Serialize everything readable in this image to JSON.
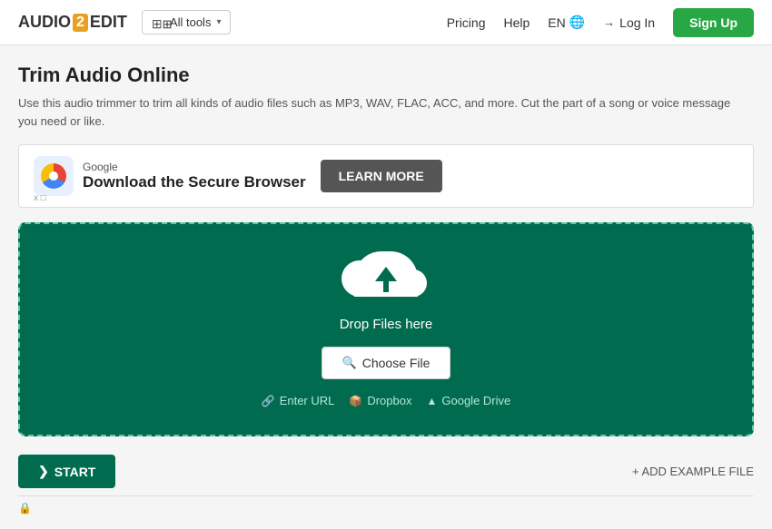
{
  "header": {
    "logo_text": "AUDIO",
    "logo_2": "2",
    "logo_edit": "EDIT",
    "all_tools_label": "All tools",
    "nav_pricing": "Pricing",
    "nav_help": "Help",
    "lang": "EN",
    "login_label": "Log In",
    "signup_label": "Sign Up"
  },
  "page": {
    "title": "Trim Audio Online",
    "description": "Use this audio trimmer to trim all kinds of audio files such as MP3, WAV, FLAC, ACC, and more. Cut the part of a song or voice message you need or like."
  },
  "ad": {
    "brand": "Google",
    "headline": "Download the Secure Browser",
    "cta": "LEARN MORE",
    "close_label": "x □"
  },
  "dropzone": {
    "drop_text": "Drop Files here",
    "choose_file_label": "Choose File",
    "enter_url_label": "Enter URL",
    "dropbox_label": "Dropbox",
    "google_drive_label": "Google Drive"
  },
  "actions": {
    "start_label": "START",
    "add_example_label": "+ ADD EXAMPLE FILE"
  },
  "icons": {
    "grid": "⊞",
    "chevron_down": "▾",
    "globe": "🌐",
    "login_arrow": "→",
    "file_search": "🔍",
    "link": "🔗",
    "dropbox": "📦",
    "google_drive": "▲",
    "chevron_right": "❯",
    "plus": "+"
  }
}
